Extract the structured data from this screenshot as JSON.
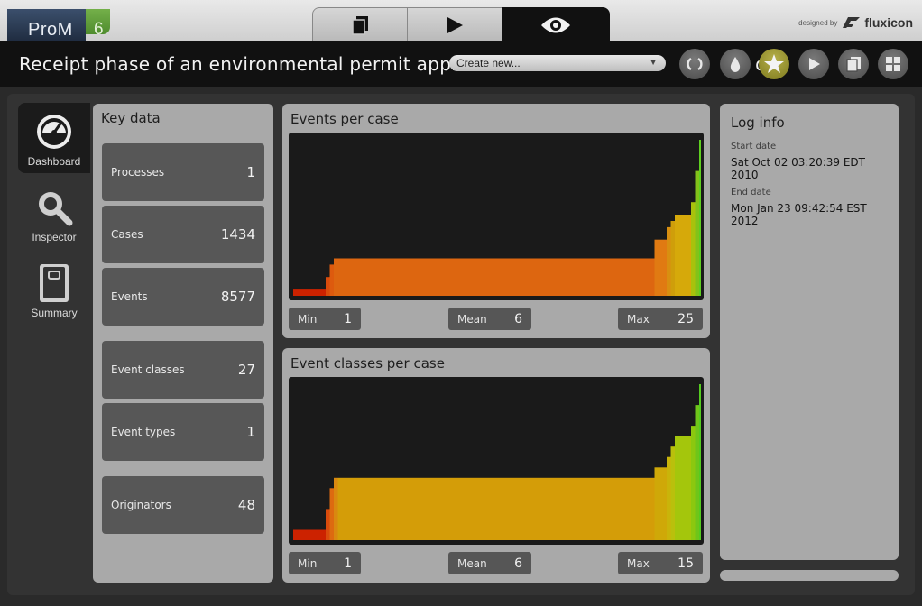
{
  "app": {
    "logo_text": "ProM",
    "logo_version": "6",
    "designed_by": "designed by",
    "brand": "fluxicon"
  },
  "mode_tabs": [
    {
      "icon": "stack-icon"
    },
    {
      "icon": "play-icon"
    },
    {
      "icon": "eye-icon",
      "active": true
    }
  ],
  "title": "Receipt phase of an environmental permit applica",
  "title_tail": "loS oCo oj",
  "toolbar": {
    "create_placeholder": "Create new...",
    "buttons": [
      {
        "icon": "refresh-icon"
      },
      {
        "icon": "drop-icon"
      },
      {
        "icon": "star-icon",
        "active": true
      },
      {
        "icon": "play-icon"
      },
      {
        "icon": "copy-icon"
      },
      {
        "icon": "grid-icon"
      }
    ]
  },
  "nav": [
    {
      "label": "Dashboard",
      "icon": "gauge-icon",
      "active": true
    },
    {
      "label": "Inspector",
      "icon": "magnifier-icon"
    },
    {
      "label": "Summary",
      "icon": "book-icon"
    }
  ],
  "key_data": {
    "title": "Key data",
    "items": [
      {
        "label": "Processes",
        "value": "1"
      },
      {
        "label": "Cases",
        "value": "1434"
      },
      {
        "label": "Events",
        "value": "8577"
      },
      {
        "label": "Event classes",
        "value": "27"
      },
      {
        "label": "Event types",
        "value": "1"
      },
      {
        "label": "Originators",
        "value": "48"
      }
    ]
  },
  "events_per_case": {
    "title": "Events per case",
    "min_label": "Min",
    "min": "1",
    "mean_label": "Mean",
    "mean": "6",
    "max_label": "Max",
    "max": "25"
  },
  "event_classes_per_case": {
    "title": "Event classes per case",
    "min_label": "Min",
    "min": "1",
    "mean_label": "Mean",
    "mean": "6",
    "max_label": "Max",
    "max": "15"
  },
  "log_info": {
    "title": "Log info",
    "start_label": "Start date",
    "start_value": "Sat Oct 02 03:20:39 EDT 2010",
    "end_label": "End date",
    "end_value": "Mon Jan 23 09:42:54 EST 2012"
  },
  "chart_data": [
    {
      "type": "bar",
      "title": "Events per case",
      "description_values": "sorted case lengths (events per case), ascending",
      "x": [
        0.0,
        0.08,
        0.09,
        0.1,
        0.11,
        0.89,
        0.92,
        0.93,
        0.94,
        0.98,
        0.99,
        1.0
      ],
      "values": [
        1,
        3,
        5,
        6,
        6,
        9,
        11,
        12,
        13,
        15,
        20,
        25
      ],
      "colors": [
        "#cc2200",
        "#d94b0c",
        "#dd5a0e",
        "#dd6610",
        "#dd6610",
        "#e07a12",
        "#d88f10",
        "#cf9e0a",
        "#d6a90a",
        "#a8c20c",
        "#82c21a",
        "#5fcf20"
      ],
      "ylim": [
        0,
        25
      ]
    },
    {
      "type": "bar",
      "title": "Event classes per case",
      "description_values": "sorted event classes per case, ascending",
      "x": [
        0.0,
        0.08,
        0.09,
        0.1,
        0.11,
        0.89,
        0.92,
        0.93,
        0.94,
        0.98,
        0.99,
        1.0
      ],
      "values": [
        1,
        3,
        5,
        6,
        6,
        7,
        8,
        9,
        10,
        11,
        13,
        15
      ],
      "colors": [
        "#cc2200",
        "#d94b0c",
        "#dd6a10",
        "#d98810",
        "#d49d08",
        "#cfa808",
        "#c9b40a",
        "#b9c00c",
        "#a4c60c",
        "#8cc80f",
        "#6fc51a",
        "#55cc20"
      ],
      "ylim": [
        0,
        15
      ]
    }
  ]
}
